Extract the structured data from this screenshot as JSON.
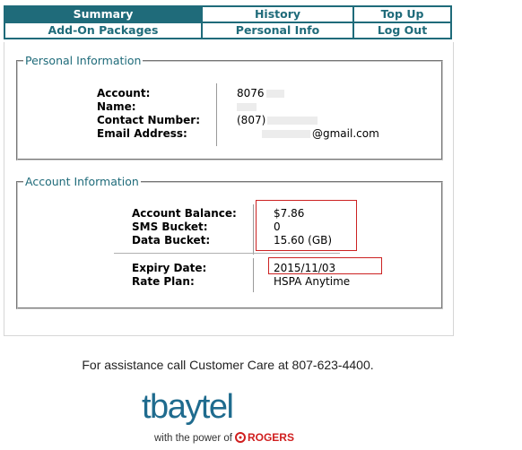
{
  "nav": {
    "row1": [
      "Summary",
      "History",
      "Top Up"
    ],
    "row2": [
      "Add-On Packages",
      "Personal Info",
      "Log Out"
    ],
    "active_tab": "Summary"
  },
  "personal": {
    "legend": "Personal Information",
    "fields": [
      {
        "label": "Account:",
        "value": "8076"
      },
      {
        "label": "Name:",
        "value": ""
      },
      {
        "label": "Contact Number:",
        "value": "(807)"
      },
      {
        "label": "Email Address:",
        "value": "@gmail.com"
      }
    ]
  },
  "account": {
    "legend": "Account Information",
    "fields": [
      {
        "label": "Account Balance:",
        "value": "$7.86"
      },
      {
        "label": "SMS Bucket:",
        "value": "0"
      },
      {
        "label": "Data Bucket:",
        "value": "15.60 (GB)"
      },
      {
        "label": "Expiry Date:",
        "value": "2015/11/03"
      },
      {
        "label": "Rate Plan:",
        "value": "HSPA Anytime"
      }
    ]
  },
  "footer": {
    "assistance": "For assistance call Customer Care at 807-623-4400.",
    "logo_word": "tbaytel",
    "logo_tag_prefix": "with the power of",
    "logo_tag_brand": "ROGERS"
  },
  "colors": {
    "brand_teal": "#1f6b7a",
    "highlight_red": "#cc2222",
    "rogers_red": "#d01f1f"
  }
}
